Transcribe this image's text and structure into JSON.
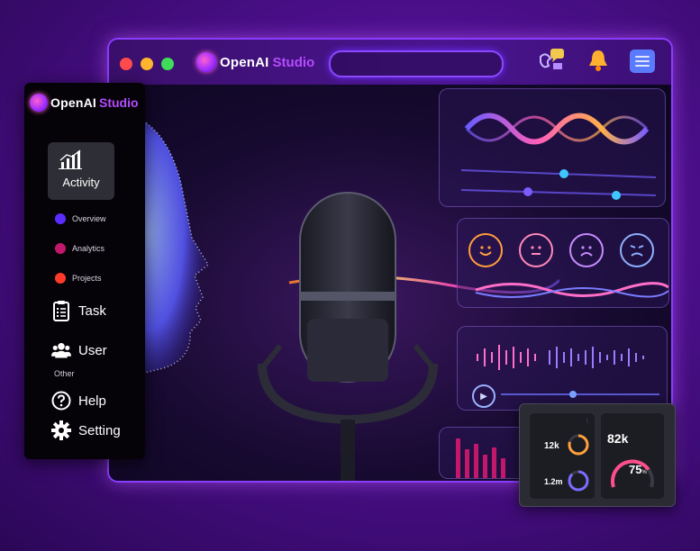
{
  "window": {
    "brand_name": "OpenAI",
    "brand_accent": "Studio",
    "search": {
      "placeholder": ""
    }
  },
  "sidebar": {
    "brand_name": "OpenAI",
    "brand_accent": "Studio",
    "activity_label": "Activity",
    "sub_items": [
      {
        "label": "Overview",
        "color": "#5a2dff"
      },
      {
        "label": "Analytics",
        "color": "#c2186b"
      },
      {
        "label": "Projects",
        "color": "#ff3a2a"
      }
    ],
    "task_label": "Task",
    "user_label": "User",
    "section_other": "Other",
    "help_label": "Help",
    "setting_label": "Setting"
  },
  "stats": {
    "value_12k": "12k",
    "value_12m": "1.2m",
    "value_82k": "82k",
    "percent_value": "75",
    "percent_sign": "%",
    "progress_fraction": 0.75
  },
  "colors": {
    "accent": "#8a3cff",
    "brand_accent": "#b64cff",
    "background": "#4b0f8a"
  }
}
